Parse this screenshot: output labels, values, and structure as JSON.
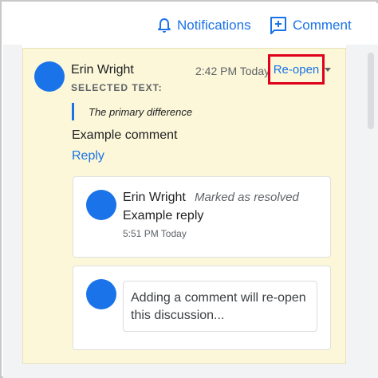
{
  "header": {
    "notifications_label": "Notifications",
    "notifications_icon": "bell-icon",
    "comment_label": "Comment",
    "comment_icon": "add-comment-icon"
  },
  "thread": {
    "author": "Erin Wright",
    "time": "2:42 PM Today",
    "reopen_label": "Re-open",
    "selected_text_label": "SELECTED TEXT:",
    "selected_text": "The primary difference",
    "comment": "Example comment",
    "reply_label": "Reply"
  },
  "reply": {
    "author": "Erin Wright",
    "status": "Marked as resolved",
    "body": "Example reply",
    "time": "5:51 PM Today"
  },
  "new_comment": {
    "placeholder": "Adding a comment will re-open this discussion..."
  },
  "colors": {
    "accent": "#1a73e8",
    "card_background": "#fbf7d8",
    "highlight_box": "#e0001b"
  }
}
